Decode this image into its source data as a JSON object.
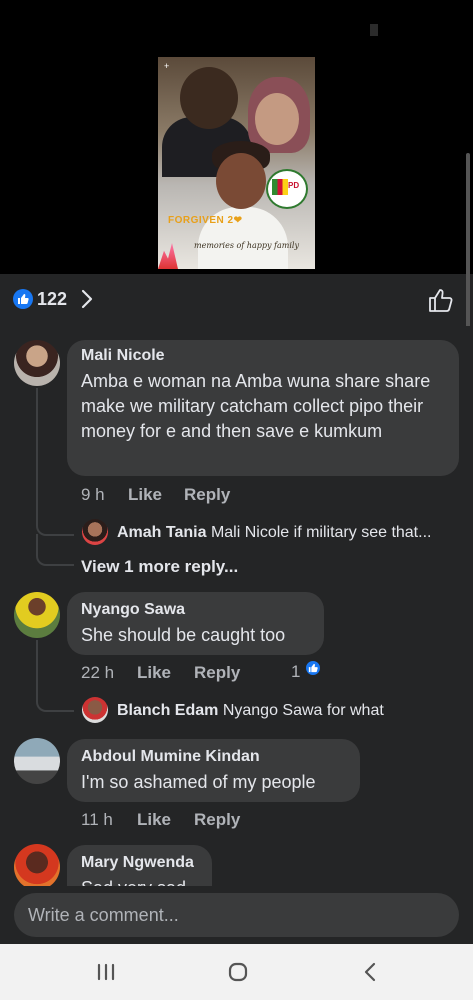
{
  "post": {
    "photo": {
      "forgiven_text": "FORGIVEN 2❤",
      "caption": "memories of happy family",
      "badge": "PD",
      "plus": "+"
    }
  },
  "reactions": {
    "count": "122"
  },
  "comments": [
    {
      "author": "Mali Nicole",
      "text": "Amba e woman na Amba wuna share share make we military catcham  collect pipo their money for e and then save e kumkum",
      "time": "9 h",
      "like_label": "Like",
      "reply_label": "Reply",
      "reply_preview": {
        "author": "Amah Tania",
        "text": "Mali Nicole if military see that..."
      },
      "more_replies": "View 1 more reply..."
    },
    {
      "author": "Nyango Sawa",
      "text": "She should be caught too",
      "time": "22 h",
      "like_label": "Like",
      "reply_label": "Reply",
      "reaction_count": "1",
      "reply_preview": {
        "author": "Blanch Edam",
        "text": "Nyango Sawa for what"
      }
    },
    {
      "author": "Abdoul Mumine Kindan",
      "text": "I'm so ashamed of my people",
      "time": "11 h",
      "like_label": "Like",
      "reply_label": "Reply"
    },
    {
      "author": "Mary Ngwenda",
      "text": "Sad very sad"
    }
  ],
  "composer": {
    "placeholder": "Write a comment..."
  },
  "colors": {
    "background": "#242526",
    "bubble": "#3a3b3c",
    "accent": "#1877f2",
    "muted": "#b0b3b8"
  },
  "icons": [
    "like-icon",
    "chevron-right-icon",
    "thumbs-up-outline-icon",
    "recent-apps-icon",
    "home-icon",
    "back-icon"
  ]
}
